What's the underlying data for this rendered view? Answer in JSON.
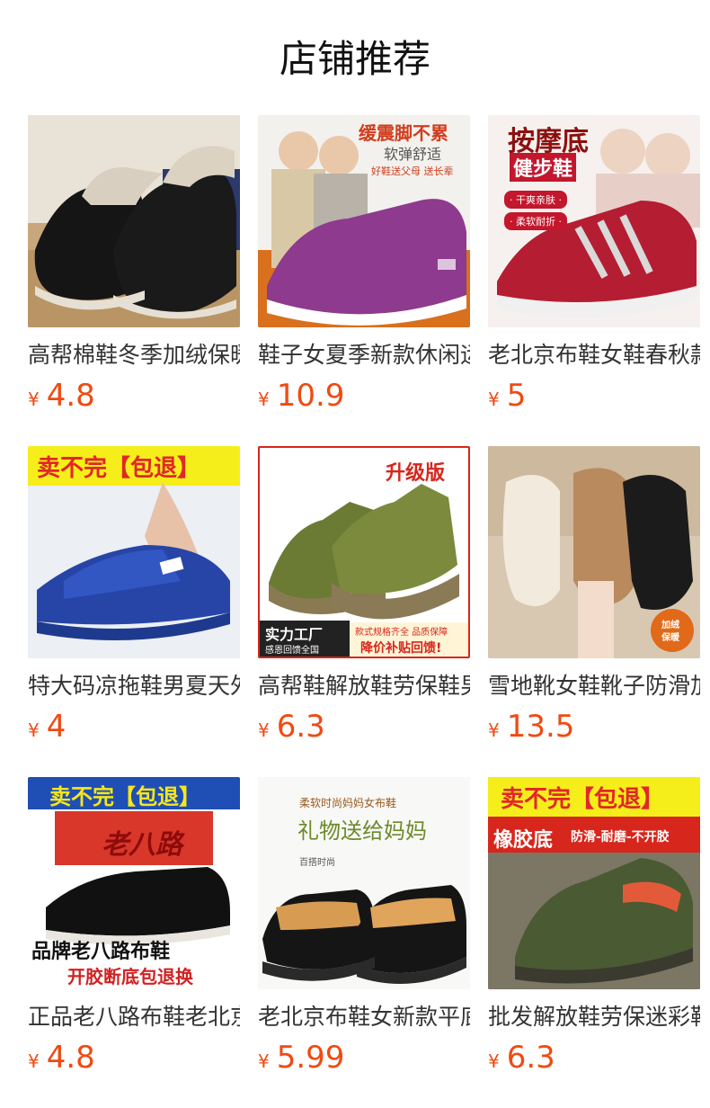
{
  "section": {
    "title": "店铺推荐"
  },
  "products": [
    {
      "name": "高帮棉鞋冬季加绒保暖",
      "currency": "¥",
      "price": "4.8",
      "image_text": []
    },
    {
      "name": "鞋子女夏季新款休闲运动",
      "currency": "¥",
      "price": "10.9",
      "image_text": [
        "缓震脚不累",
        "软弹舒适",
        "好鞋送父母 送长辈"
      ]
    },
    {
      "name": "老北京布鞋女鞋春秋款",
      "currency": "¥",
      "price": "5",
      "image_text": [
        "按摩底",
        "健步鞋",
        "· 干爽亲肤 ·",
        "· 柔软耐折 ·"
      ]
    },
    {
      "name": "特大码凉拖鞋男夏天外穿",
      "currency": "¥",
      "price": "4",
      "image_text": [
        "卖不完【包退】"
      ]
    },
    {
      "name": "高帮鞋解放鞋劳保鞋男",
      "currency": "¥",
      "price": "6.3",
      "image_text": [
        "升级版",
        "实力工厂",
        "感恩回馈全国",
        "款式规格齐全 品质保障",
        "降价补贴回馈!"
      ]
    },
    {
      "name": "雪地靴女鞋靴子防滑加绒",
      "currency": "¥",
      "price": "13.5",
      "image_text": [
        "加绒",
        "保暖"
      ]
    },
    {
      "name": "正品老八路布鞋老北京",
      "currency": "¥",
      "price": "4.8",
      "image_text": [
        "卖不完【包退】",
        "老八路",
        "品牌老八路布鞋",
        "开胶断底包退换"
      ]
    },
    {
      "name": "老北京布鞋女新款平底",
      "currency": "¥",
      "price": "5.99",
      "image_text": [
        "柔软时尚妈妈女布鞋",
        "礼物送给妈妈",
        "百搭时尚"
      ]
    },
    {
      "name": "批发解放鞋劳保迷彩鞋",
      "currency": "¥",
      "price": "6.3",
      "image_text": [
        "卖不完【包退】",
        "橡胶底",
        "防滑-耐磨-不开胶"
      ]
    }
  ],
  "colors": {
    "price": "#f04a12",
    "title": "#111111"
  }
}
